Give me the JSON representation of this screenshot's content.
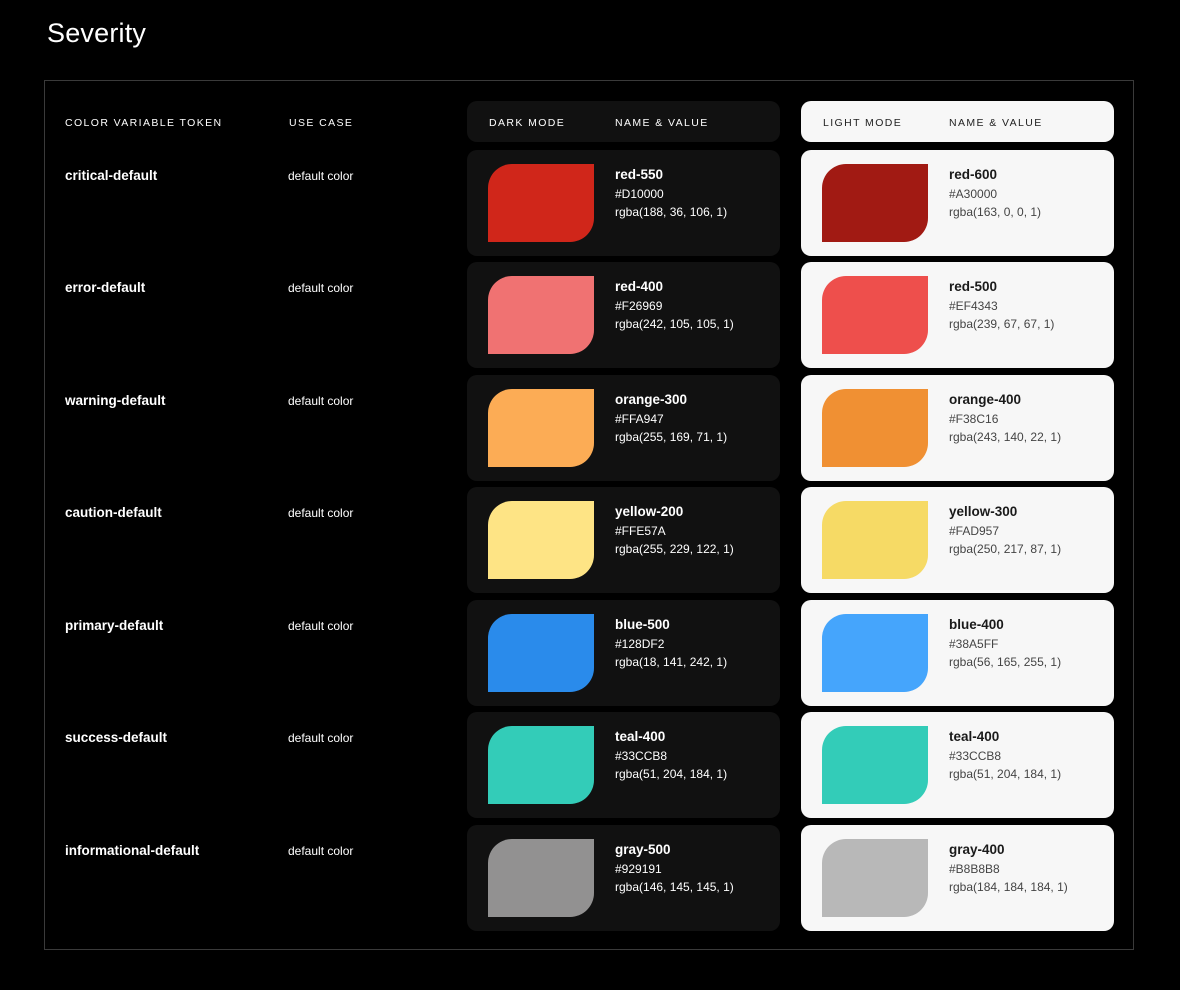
{
  "title": "Severity",
  "headers": {
    "token": "COLOR VARIABLE TOKEN",
    "use_case": "USE CASE",
    "dark_mode": "DARK MODE",
    "dark_name_value": "NAME & VALUE",
    "light_mode": "LIGHT MODE",
    "light_name_value": "NAME & VALUE"
  },
  "rows": [
    {
      "token": "critical-default",
      "use_case": "default color",
      "dark": {
        "name": "red-550",
        "hex": "#D10000",
        "rgba": "rgba(188, 36, 106, 1)",
        "color": "#D0261A"
      },
      "light": {
        "name": "red-600",
        "hex": "#A30000",
        "rgba": "rgba(163, 0, 0, 1)",
        "color": "#A11A13"
      }
    },
    {
      "token": "error-default",
      "use_case": "default color",
      "dark": {
        "name": "red-400",
        "hex": "#F26969",
        "rgba": "rgba(242, 105, 105, 1)",
        "color": "#F07272"
      },
      "light": {
        "name": "red-500",
        "hex": "#EF4343",
        "rgba": "rgba(239, 67, 67, 1)",
        "color": "#EE4F4C"
      }
    },
    {
      "token": "warning-default",
      "use_case": "default color",
      "dark": {
        "name": "orange-300",
        "hex": "#FFA947",
        "rgba": "rgba(255, 169, 71, 1)",
        "color": "#FCAC55"
      },
      "light": {
        "name": "orange-400",
        "hex": "#F38C16",
        "rgba": "rgba(243, 140, 22, 1)",
        "color": "#F09033"
      }
    },
    {
      "token": "caution-default",
      "use_case": "default color",
      "dark": {
        "name": "yellow-200",
        "hex": "#FFE57A",
        "rgba": "rgba(255, 229, 122, 1)",
        "color": "#FEE485"
      },
      "light": {
        "name": "yellow-300",
        "hex": "#FAD957",
        "rgba": "rgba(250, 217, 87, 1)",
        "color": "#F6DA65"
      }
    },
    {
      "token": "primary-default",
      "use_case": "default color",
      "dark": {
        "name": "blue-500",
        "hex": "#128DF2",
        "rgba": "rgba(18, 141, 242, 1)",
        "color": "#2A8BEB"
      },
      "light": {
        "name": "blue-400",
        "hex": "#38A5FF",
        "rgba": "rgba(56, 165, 255, 1)",
        "color": "#45A5FC"
      }
    },
    {
      "token": "success-default",
      "use_case": "default color",
      "dark": {
        "name": "teal-400",
        "hex": "#33CCB8",
        "rgba": "rgba(51, 204, 184, 1)",
        "color": "#33CCB8"
      },
      "light": {
        "name": "teal-400",
        "hex": "#33CCB8",
        "rgba": "rgba(51, 204, 184, 1)",
        "color": "#33CCB8"
      }
    },
    {
      "token": "informational-default",
      "use_case": "default color",
      "dark": {
        "name": "gray-500",
        "hex": "#929191",
        "rgba": "rgba(146, 145, 145, 1)",
        "color": "#929191"
      },
      "light": {
        "name": "gray-400",
        "hex": "#B8B8B8",
        "rgba": "rgba(184, 184, 184, 1)",
        "color": "#B8B8B8"
      }
    }
  ]
}
